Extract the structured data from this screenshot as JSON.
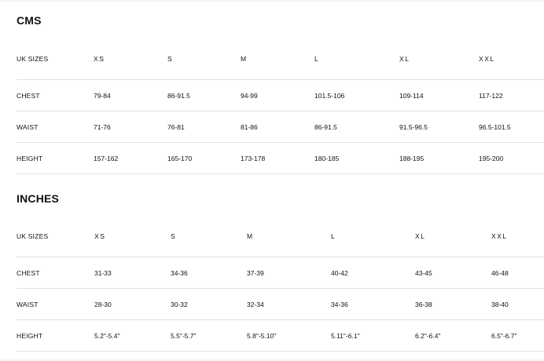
{
  "cms": {
    "title": "CMS",
    "header": [
      "UK SIZES",
      "XS",
      "S",
      "M",
      "L",
      "XL",
      "XXL"
    ],
    "rows": [
      {
        "label": "CHEST",
        "values": [
          "79-84",
          "86-91.5",
          "94-99",
          "101.5-106",
          "109-114",
          "117-122"
        ]
      },
      {
        "label": "WAIST",
        "values": [
          "71-76",
          "76-81",
          "81-86",
          "86-91.5",
          "91.5-96.5",
          "96.5-101.5"
        ]
      },
      {
        "label": "HEIGHT",
        "values": [
          "157-162",
          "165-170",
          "173-178",
          "180-185",
          "188-195",
          "195-200"
        ]
      }
    ]
  },
  "inches": {
    "title": "INCHES",
    "header": [
      "UK SIZES",
      "XS",
      "S",
      "M",
      "L",
      "XL",
      "XXL"
    ],
    "rows": [
      {
        "label": "CHEST",
        "values": [
          "31-33",
          "34-36",
          "37-39",
          "40-42",
          "43-45",
          "46-48"
        ]
      },
      {
        "label": "WAIST",
        "values": [
          "28-30",
          "30-32",
          "32-34",
          "34-36",
          "36-38",
          "38-40"
        ]
      },
      {
        "label": "HEIGHT",
        "values": [
          "5.2\"-5.4\"",
          "5.5\"-5.7\"",
          "5.8\"-5.10\"",
          "5.11\"-6.1\"",
          "6.2\"-6.4\"",
          "6.5\"-6.7\""
        ]
      }
    ]
  }
}
